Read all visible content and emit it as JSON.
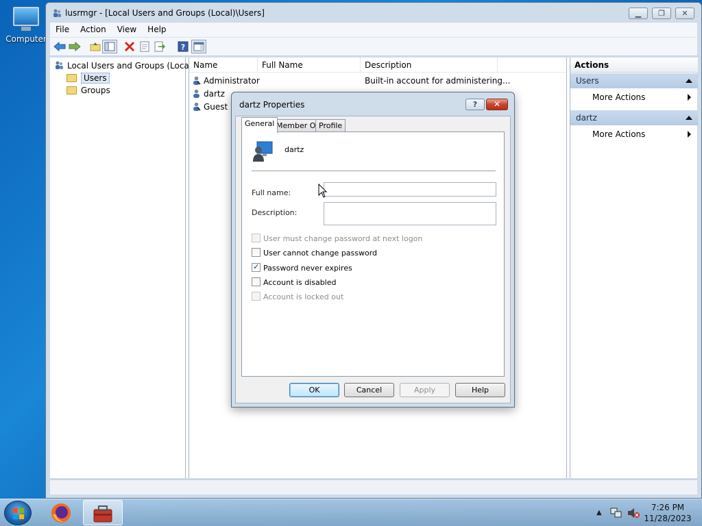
{
  "desktop": {
    "computer_label": "Computer"
  },
  "window": {
    "title": "lusrmgr - [Local Users and Groups (Local)\\Users]",
    "menu": [
      "File",
      "Action",
      "View",
      "Help"
    ],
    "tree": {
      "root": "Local Users and Groups (Local)",
      "children": [
        "Users",
        "Groups"
      ],
      "selected": "Users"
    },
    "list": {
      "columns": [
        "Name",
        "Full Name",
        "Description"
      ],
      "rows": [
        {
          "name": "Administrator",
          "full_name": "",
          "description": "Built-in account for administering..."
        },
        {
          "name": "dartz",
          "full_name": "",
          "description": ""
        },
        {
          "name": "Guest",
          "full_name": "",
          "description": ""
        }
      ]
    },
    "actions": {
      "header": "Actions",
      "sections": [
        {
          "title": "Users",
          "item": "More Actions"
        },
        {
          "title": "dartz",
          "item": "More Actions"
        }
      ]
    }
  },
  "dialog": {
    "title": "dartz Properties",
    "help_glyph": "?",
    "tabs": [
      "General",
      "Member Of",
      "Profile"
    ],
    "active_tab": "General",
    "user_name": "dartz",
    "full_name_label": "Full name:",
    "full_name_value": "",
    "description_label": "Description:",
    "description_value": "",
    "checkboxes": [
      {
        "label": "User must change password at next logon",
        "checked": false,
        "enabled": false
      },
      {
        "label": "User cannot change password",
        "checked": false,
        "enabled": true
      },
      {
        "label": "Password never expires",
        "checked": true,
        "enabled": true
      },
      {
        "label": "Account is disabled",
        "checked": false,
        "enabled": true
      },
      {
        "label": "Account is locked out",
        "checked": false,
        "enabled": false
      }
    ],
    "buttons": {
      "ok": "OK",
      "cancel": "Cancel",
      "apply": "Apply",
      "help": "Help"
    }
  },
  "taskbar": {
    "time": "7:26 PM",
    "date": "11/28/2023"
  },
  "colors": {
    "desktop": "#1a86d6",
    "selection": "#dde8f5",
    "actions_section": "#c9daee"
  },
  "icons": [
    "computer-icon",
    "users-group-icon",
    "folder-icon",
    "user-icon",
    "back-icon",
    "forward-icon",
    "delete-icon",
    "help-icon",
    "start-orb-icon",
    "firefox-icon",
    "toolbox-icon",
    "network-icon",
    "volume-muted-icon"
  ]
}
